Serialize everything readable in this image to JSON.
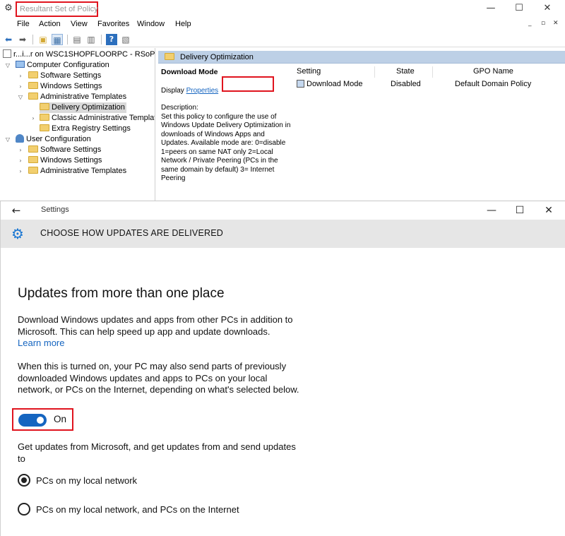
{
  "rsop": {
    "title": "Resultant Set of Policy",
    "menu": [
      "File",
      "Action",
      "View",
      "Favorites",
      "Window",
      "Help"
    ],
    "window_controls": {
      "minimize": "—",
      "maximize": "☐",
      "close": "✕"
    },
    "mdi_controls": {
      "minimize": "_",
      "restore": "▫",
      "close": "✕"
    },
    "tree": {
      "root": "r...i...r on WSC1SHOPFLOORPC - RSoP",
      "computer_config": "Computer Configuration",
      "software_settings": "Software Settings",
      "windows_settings": "Windows Settings",
      "admin_templates": "Administrative Templates",
      "delivery_optimization": "Delivery Optimization",
      "classic_admin": "Classic Administrative Templates",
      "extra_registry": "Extra Registry Settings",
      "user_config": "User Configuration",
      "user_software_settings": "Software Settings",
      "user_windows_settings": "Windows Settings",
      "user_admin_templates": "Administrative Templates"
    },
    "detail": {
      "header": "Delivery Optimization",
      "policy_name": "Download Mode",
      "display_label": "Display",
      "properties_link": "Properties",
      "description_label": "Description:",
      "description": "Set this policy to configure the use of Windows Update Delivery Optimization in downloads of Windows Apps and Updates. Available mode are: 0=disable 1=peers on same NAT only 2=Local Network / Private Peering (PCs in the same domain by default) 3= Internet Peering",
      "columns": {
        "setting": "Setting",
        "state": "State",
        "gpo_name": "GPO Name"
      },
      "row": {
        "setting": "Download Mode",
        "state": "Disabled",
        "gpo_name": "Default Domain Policy"
      }
    }
  },
  "settings": {
    "title": "Settings",
    "window_controls": {
      "minimize": "—",
      "maximize": "☐",
      "close": "✕"
    },
    "header": "CHOOSE HOW UPDATES ARE DELIVERED",
    "section_title": "Updates from more than one place",
    "intro": "Download Windows updates and apps from other PCs in addition to Microsoft. This can help speed up app and update downloads.",
    "learn_more": "Learn more",
    "when_on": "When this is turned on, your PC may also send parts of previously downloaded Windows updates and apps to PCs on your local network, or PCs on the Internet, depending on what's selected below.",
    "toggle": {
      "state": "On",
      "value": true
    },
    "get_updates": "Get updates from Microsoft, and get updates from and send updates to",
    "options": [
      {
        "label": "PCs on my local network",
        "selected": true
      },
      {
        "label": "PCs on my local network, and PCs on the Internet",
        "selected": false
      }
    ]
  }
}
